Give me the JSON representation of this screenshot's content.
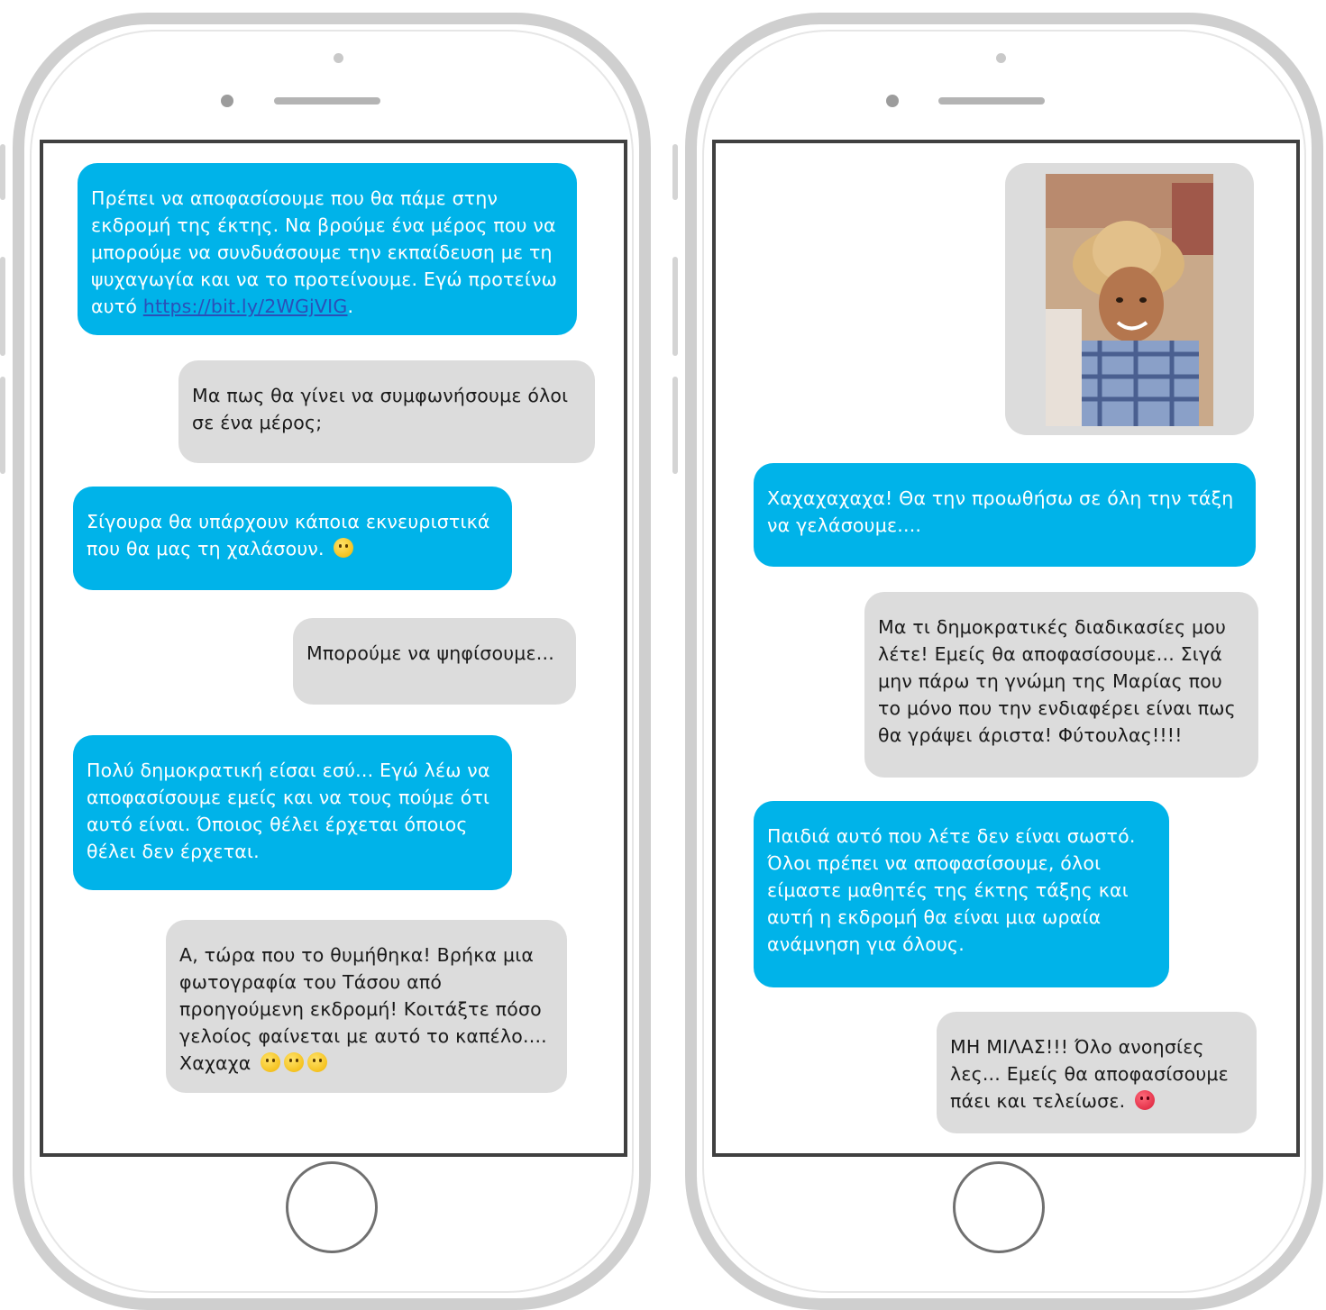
{
  "left_phone": {
    "messages": [
      {
        "side": "sent",
        "color": "blue",
        "text": "Πρέπει να αποφασίσουμε που θα πάμε στην εκδρομή της έκτης. Να βρούμε ένα μέρος που να μπορούμε να συνδυάσουμε την εκπαίδευση με τη ψυχαγωγία και να το προτείνουμε. Εγώ προτείνω αυτό ",
        "link": "https://bit.ly/2WGjVIG",
        "after_link": "."
      },
      {
        "side": "received",
        "color": "gray",
        "text": "Μα πως θα γίνει να συμφωνήσουμε όλοι σε ένα μέρος;"
      },
      {
        "side": "sent",
        "color": "blue",
        "text": "Σίγουρα θα υπάρχουν κάποια εκνευριστικά που θα μας τη χαλάσουν.",
        "emoji": "yum-face-icon"
      },
      {
        "side": "received",
        "color": "gray",
        "text": "Μπορούμε να ψηφίσουμε..."
      },
      {
        "side": "sent",
        "color": "blue",
        "text": "Πολύ δημοκρατική είσαι εσύ... Εγώ λέω να αποφασίσουμε εμείς και να τους πούμε ότι αυτό είναι. Όποιος θέλει έρχεται όποιος θέλει δεν έρχεται."
      },
      {
        "side": "received",
        "color": "gray",
        "text": "Α, τώρα που το θυμήθηκα! Βρήκα μια φωτογραφία του Τάσου από προηγούμενη εκδρομή! Κοιτάξτε πόσο γελοίος φαίνεται με αυτό το καπέλο.... Χαχαχα",
        "emoji": "tears-of-joy-icon"
      }
    ]
  },
  "right_phone": {
    "photo": {
      "description_icon": "photo-cowboy-boy-icon"
    },
    "messages": [
      {
        "side": "sent",
        "color": "blue",
        "text": "Χαχαχαχαχα! Θα την προωθήσω σε όλη την τάξη να γελάσουμε...."
      },
      {
        "side": "received",
        "color": "gray",
        "text": "Μα τι δημοκρατικές διαδικασίες μου λέτε! Εμείς θα αποφασίσουμε... Σιγά μην πάρω τη γνώμη της Μαρίας που το μόνο που την ενδιαφέρει είναι πως θα γράψει άριστα! Φύτουλας!!!!"
      },
      {
        "side": "sent",
        "color": "blue",
        "text": "Παιδιά αυτό που λέτε δεν είναι σωστό. Όλοι πρέπει να αποφασίσουμε, όλοι είμαστε μαθητές της έκτης τάξης και αυτή η εκδρομή θα είναι μια ωραία ανάμνηση για όλους."
      },
      {
        "side": "received",
        "color": "gray",
        "text": "ΜΗ ΜΙΛΑΣ!!! Όλο ανοησίες λες... Εμείς θα αποφασίσουμε πάει και τελείωσε.",
        "emoji": "angry-face-icon"
      }
    ]
  },
  "colors": {
    "blue_bubble": "#00b3e9",
    "gray_bubble": "#dcdcdc",
    "link": "#2b4fb8"
  }
}
